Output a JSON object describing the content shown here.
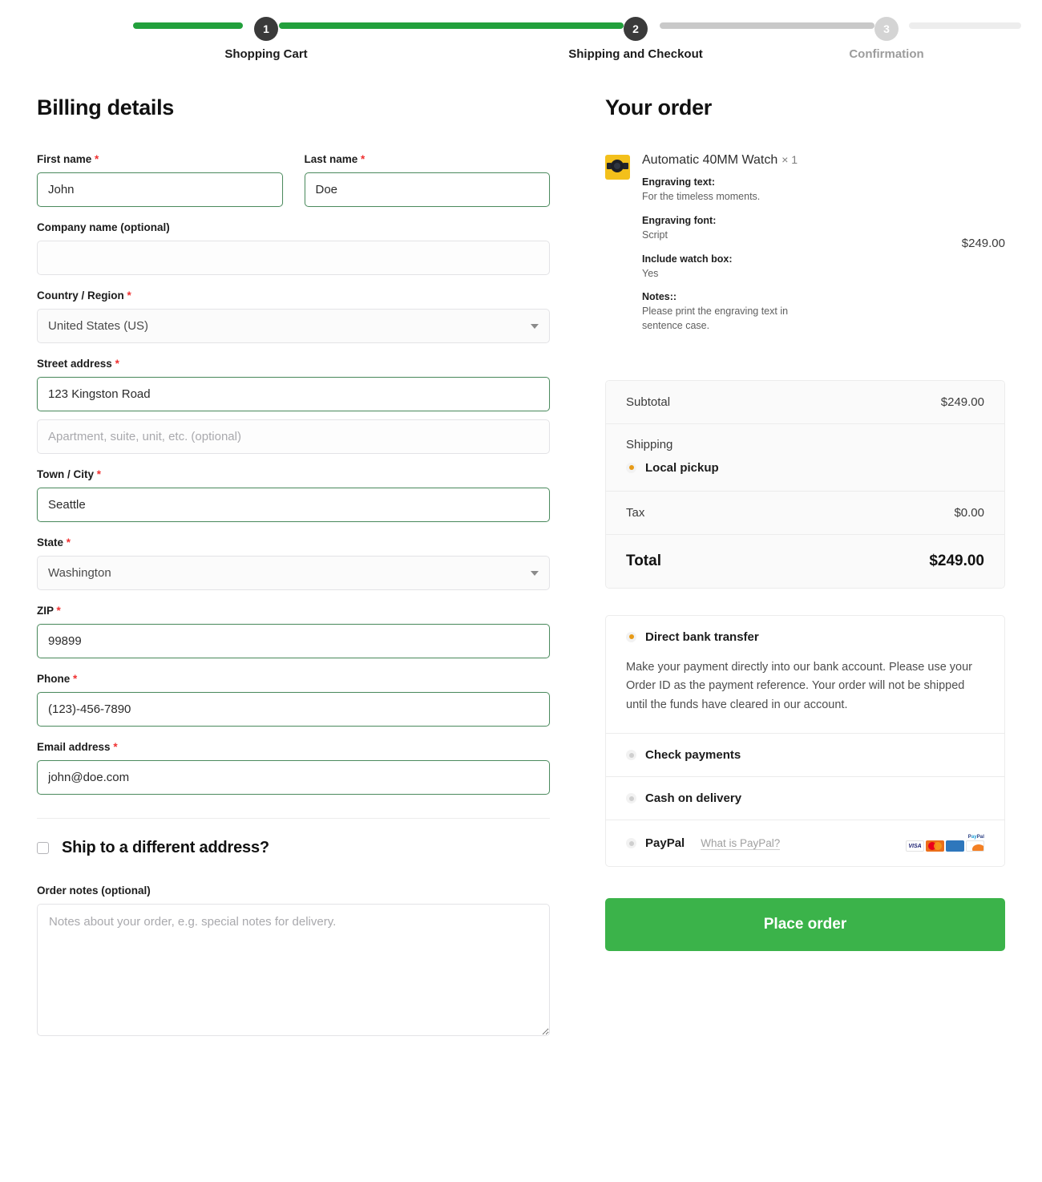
{
  "progress": {
    "steps": [
      {
        "number": "1",
        "label": "Shopping Cart",
        "state": "complete"
      },
      {
        "number": "2",
        "label": "Shipping and Checkout",
        "state": "current"
      },
      {
        "number": "3",
        "label": "Confirmation",
        "state": "upcoming"
      }
    ],
    "complete_color": "#22a03c",
    "pending_color": "#c9c9c9"
  },
  "billing": {
    "heading": "Billing details",
    "required_mark": "*",
    "first_name": {
      "label": "First name",
      "value": "John",
      "required": true
    },
    "last_name": {
      "label": "Last name",
      "value": "Doe",
      "required": true
    },
    "company": {
      "label": "Company name (optional)",
      "value": "",
      "placeholder": ""
    },
    "country": {
      "label": "Country / Region",
      "value": "United States (US)",
      "required": true
    },
    "street": {
      "label": "Street address",
      "value": "123 Kingston Road",
      "required": true
    },
    "apartment": {
      "placeholder": "Apartment, suite, unit, etc. (optional)",
      "value": ""
    },
    "city": {
      "label": "Town / City",
      "value": "Seattle",
      "required": true
    },
    "state": {
      "label": "State",
      "value": "Washington",
      "required": true
    },
    "zip": {
      "label": "ZIP",
      "value": "99899",
      "required": true
    },
    "phone": {
      "label": "Phone",
      "value": "(123)-456-7890",
      "required": true
    },
    "email": {
      "label": "Email address",
      "value": "john@doe.com",
      "required": true
    },
    "ship_different": {
      "label": "Ship to a different address?",
      "checked": false
    },
    "order_notes": {
      "label": "Order notes (optional)",
      "value": "",
      "placeholder": "Notes about your order, e.g. special notes for delivery."
    }
  },
  "order": {
    "heading": "Your order",
    "item": {
      "name": "Automatic 40MM Watch",
      "quantity": "× 1",
      "price": "$249.00",
      "meta": [
        {
          "key": "Engraving text:",
          "value": "For the timeless moments."
        },
        {
          "key": "Engraving font:",
          "value": "Script"
        },
        {
          "key": "Include watch box:",
          "value": "Yes"
        },
        {
          "key": "Notes::",
          "value": "Please print the engraving text in sentence case."
        }
      ]
    },
    "totals": {
      "subtotal_label": "Subtotal",
      "subtotal_value": "$249.00",
      "shipping_label": "Shipping",
      "shipping_option": "Local pickup",
      "tax_label": "Tax",
      "tax_value": "$0.00",
      "total_label": "Total",
      "total_value": "$249.00"
    },
    "payment_methods": [
      {
        "name": "Direct bank transfer",
        "selected": true,
        "description": "Make your payment directly into our bank account. Please use your Order ID as the payment reference. Your order will not be shipped until the funds have cleared in our account."
      },
      {
        "name": "Check payments",
        "selected": false,
        "description": ""
      },
      {
        "name": "Cash on delivery",
        "selected": false,
        "description": ""
      },
      {
        "name": "PayPal",
        "selected": false,
        "description": "",
        "help_link": "What is PayPal?"
      }
    ],
    "cards": [
      "VISA",
      "Mastercard",
      "Amex",
      "Discover"
    ],
    "paypal_wordmark_p": "P",
    "paypal_wordmark_ay": "ay",
    "paypal_wordmark_pal": "Pal",
    "place_order_label": "Place order",
    "accent_color": "#3bb34a",
    "radio_selected_color": "#e79a16"
  }
}
